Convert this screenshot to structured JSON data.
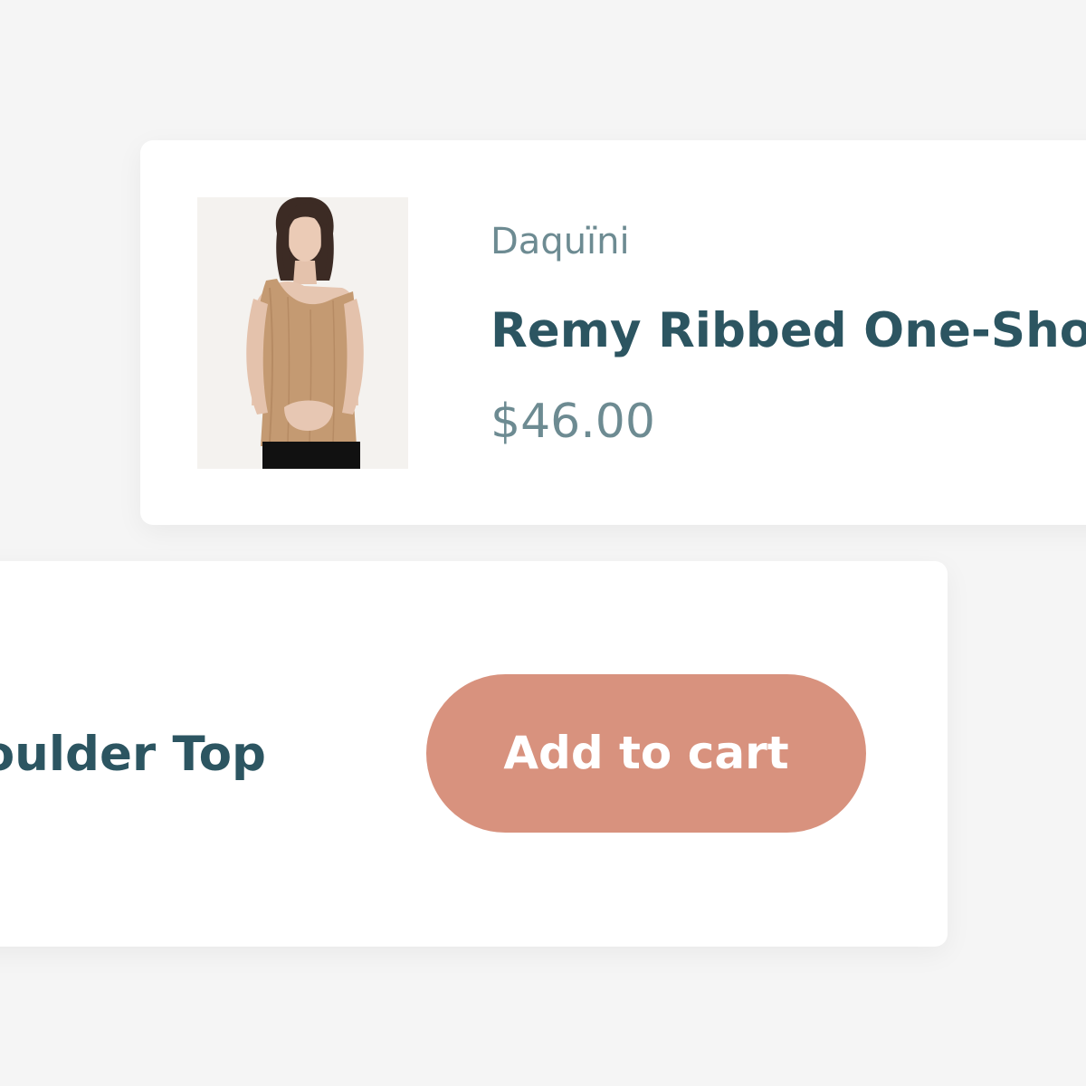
{
  "product": {
    "brand": "Daquïni",
    "title": "Remy Ribbed One-Shoulder Top",
    "title_visible_start": "Remy Ribbed One-Shou",
    "title_visible_end": "oulder Top",
    "price": "$46.00",
    "image_icon": "product-photo"
  },
  "cart": {
    "add_label": "Add to cart"
  },
  "colors": {
    "background": "#f5f5f5",
    "card": "#ffffff",
    "title": "#2c5561",
    "muted": "#6d8b92",
    "button": "#d8927e",
    "button_text": "#ffffff"
  }
}
